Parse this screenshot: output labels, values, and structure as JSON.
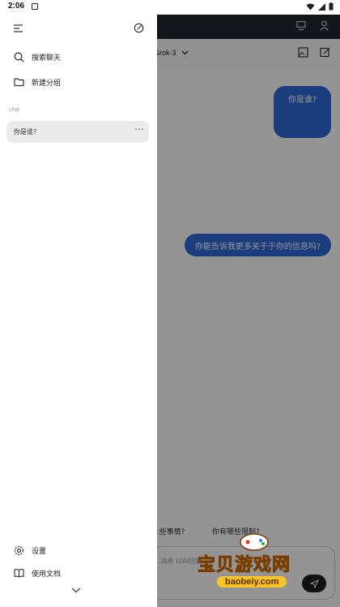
{
  "status_bar": {
    "time": "2:06"
  },
  "main": {
    "model_name": "Grok-3",
    "messages": [
      {
        "role": "user",
        "text": "你是谁?"
      },
      {
        "role": "user",
        "text": "你能告诉我更多关于于你的信息吗?"
      }
    ],
    "suggestions": [
      "...些事情?",
      "你有哪些限制?"
    ],
    "input_placeholder": "...消息 以AI回复..."
  },
  "drawer": {
    "search_label": "搜索聊天",
    "new_group_label": "新建分组",
    "section_label": "chat",
    "chats": [
      {
        "title": "你是谁?"
      }
    ],
    "settings_label": "设置",
    "docs_label": "使用文档"
  },
  "watermark": {
    "brand": "宝贝游戏网",
    "url": "baobeiy.com"
  },
  "colors": {
    "bubble": "#2f6ad9",
    "topbar": "#242730",
    "drawer": "#ffffff",
    "selected_item": "#ebebeb",
    "watermark": "#f7c325"
  }
}
